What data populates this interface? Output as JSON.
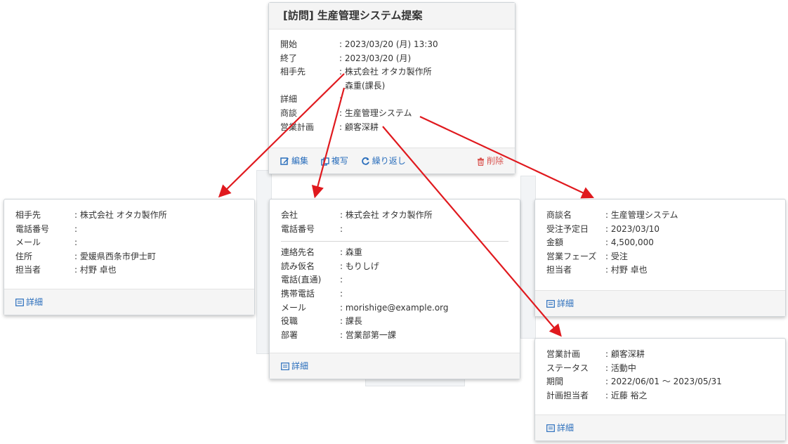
{
  "event": {
    "title": "[訪問] 生産管理システム提案",
    "rows": [
      {
        "label": "開始",
        "value": ": 2023/03/20 (月) 13:30"
      },
      {
        "label": "終了",
        "value": ": 2023/03/20 (月)"
      },
      {
        "label": "相手先",
        "value": ": 株式会社 オタカ製作所"
      },
      {
        "label": "",
        "value": "森重(課長)"
      },
      {
        "label": "詳細",
        "value": ":"
      },
      {
        "label": "商談",
        "value": ": 生産管理システム"
      },
      {
        "label": "営業計画",
        "value": ": 顧客深耕"
      }
    ],
    "actions": {
      "edit": "編集",
      "copy": "複写",
      "repeat": "繰り返し",
      "delete": "削除"
    }
  },
  "customer": {
    "rows": [
      {
        "label": "相手先",
        "value": ": 株式会社 オタカ製作所"
      },
      {
        "label": "電話番号",
        "value": ":"
      },
      {
        "label": "メール",
        "value": ":"
      },
      {
        "label": "住所",
        "value": ": 愛媛県西条市伊士町"
      },
      {
        "label": "担当者",
        "value": ": 村野 卓也"
      }
    ],
    "detail": "詳細"
  },
  "contact": {
    "company_rows": [
      {
        "label": "会社",
        "value": ": 株式会社 オタカ製作所"
      },
      {
        "label": "電話番号",
        "value": ":"
      }
    ],
    "person_rows": [
      {
        "label": "連絡先名",
        "value": ": 森重"
      },
      {
        "label": "読み仮名",
        "value": ": もりしげ"
      },
      {
        "label": "電話(直通)",
        "value": ":"
      },
      {
        "label": "携帯電話",
        "value": ":"
      },
      {
        "label": "メール",
        "value": ": morishige@example.org"
      },
      {
        "label": "役職",
        "value": ": 課長"
      },
      {
        "label": "部署",
        "value": ": 営業部第一課"
      }
    ],
    "detail": "詳細"
  },
  "deal": {
    "rows": [
      {
        "label": "商談名",
        "value": ": 生産管理システム"
      },
      {
        "label": "受注予定日",
        "value": ": 2023/03/10"
      },
      {
        "label": "金額",
        "value": ": 4,500,000"
      },
      {
        "label": "営業フェーズ",
        "value": ": 受注"
      },
      {
        "label": "担当者",
        "value": ": 村野 卓也"
      }
    ],
    "detail": "詳細"
  },
  "plan": {
    "rows": [
      {
        "label": "営業計画",
        "value": ": 顧客深耕"
      },
      {
        "label": "ステータス",
        "value": ": 活動中"
      },
      {
        "label": "期間",
        "value": ": 2022/06/01 ～ 2023/05/31"
      },
      {
        "label": "計画担当者",
        "value": ": 近藤 裕之"
      }
    ],
    "detail": "詳細"
  },
  "colors": {
    "arrow": "#e0191e",
    "link": "#2a6ebc",
    "danger": "#d9534f"
  }
}
